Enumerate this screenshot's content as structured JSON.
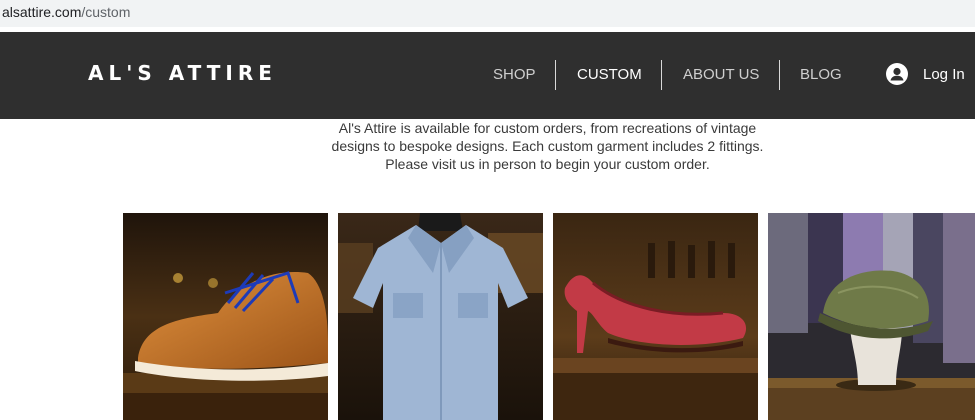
{
  "browser": {
    "url_host": "alsattire.com",
    "url_path": "/custom"
  },
  "header": {
    "logo": "AL'S ATTIRE",
    "nav": [
      "SHOP",
      "CUSTOM",
      "ABOUT US",
      "BLOG"
    ],
    "active_nav": "CUSTOM",
    "login_label": "Log In"
  },
  "intro": {
    "lines": [
      "Al's Attire is available for custom orders, from recreations of vintage",
      "designs to bespoke designs. Each custom garment includes 2 fittings.",
      "Please visit us in person to begin your custom order."
    ]
  },
  "gallery": {
    "items": [
      {
        "subject": "tan leather shoe with blue laces"
      },
      {
        "subject": "light blue short-sleeve shirt on mannequin"
      },
      {
        "subject": "red heeled shoe"
      },
      {
        "subject": "olive tweed flat cap on stand"
      }
    ]
  },
  "colors": {
    "header_bg": "#2f2f2f",
    "url_bar_bg": "#f1f3f4",
    "text": "#3a3a3a"
  }
}
